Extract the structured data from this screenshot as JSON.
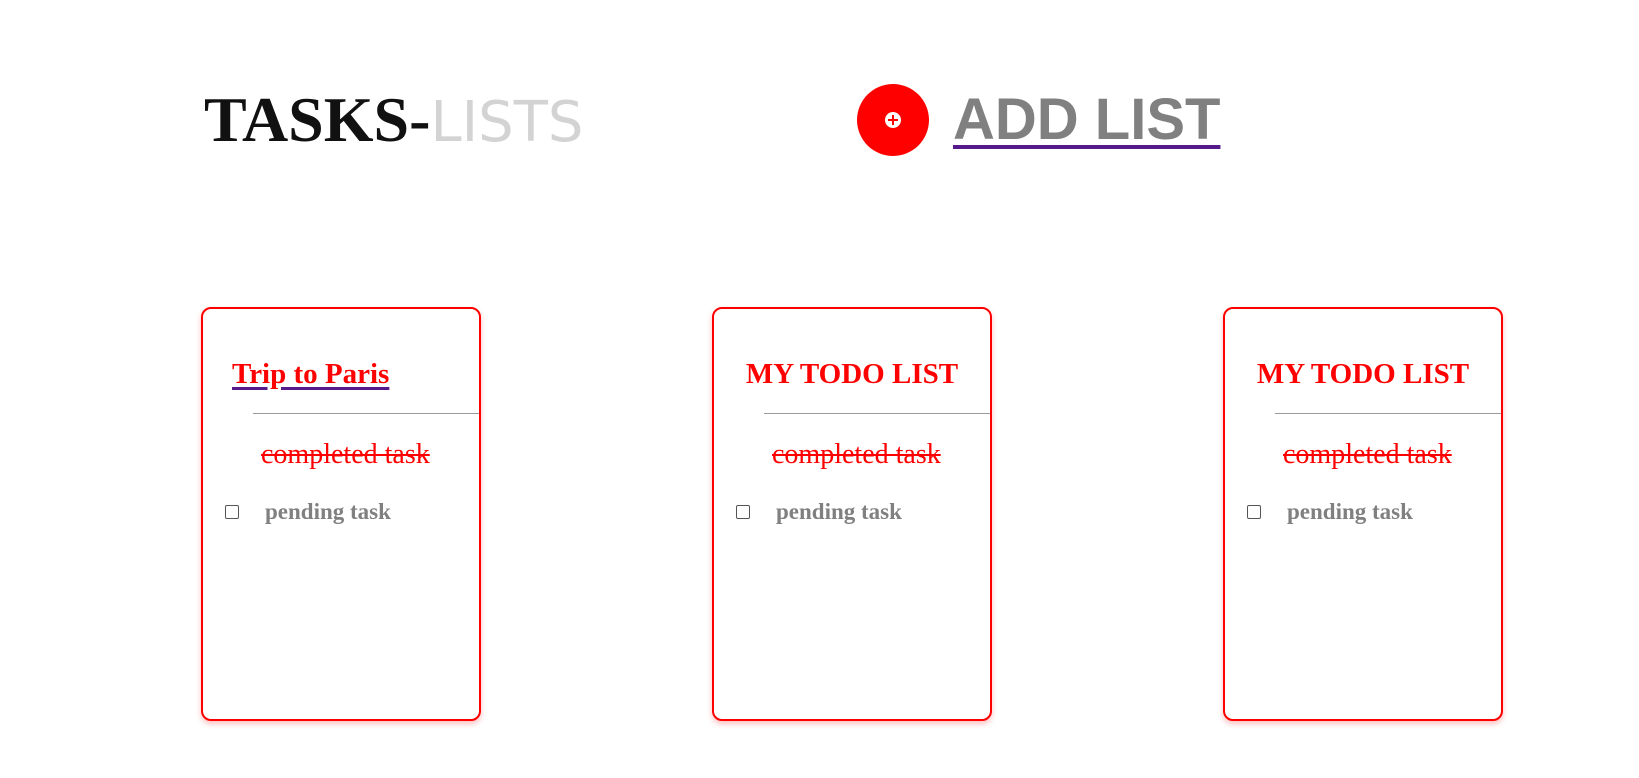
{
  "header": {
    "title_main": "TASKS-",
    "title_accent": "LISTS",
    "add_list_label": "ADD LIST",
    "add_list_icon": "plus-circle-icon"
  },
  "colors": {
    "accent": "#ff0000",
    "muted_text": "#808080",
    "title_accent": "#d3d3d3",
    "link_underline": "#551a8b"
  },
  "lists": [
    {
      "title": "Trip to Paris",
      "completed_task": "completed task",
      "pending_task": "pending task",
      "pending_checked": false
    },
    {
      "title": "MY TODO LIST",
      "completed_task": "completed task",
      "pending_task": "pending task",
      "pending_checked": false
    },
    {
      "title": "MY TODO LIST",
      "completed_task": "completed task",
      "pending_task": "pending task",
      "pending_checked": false
    }
  ]
}
